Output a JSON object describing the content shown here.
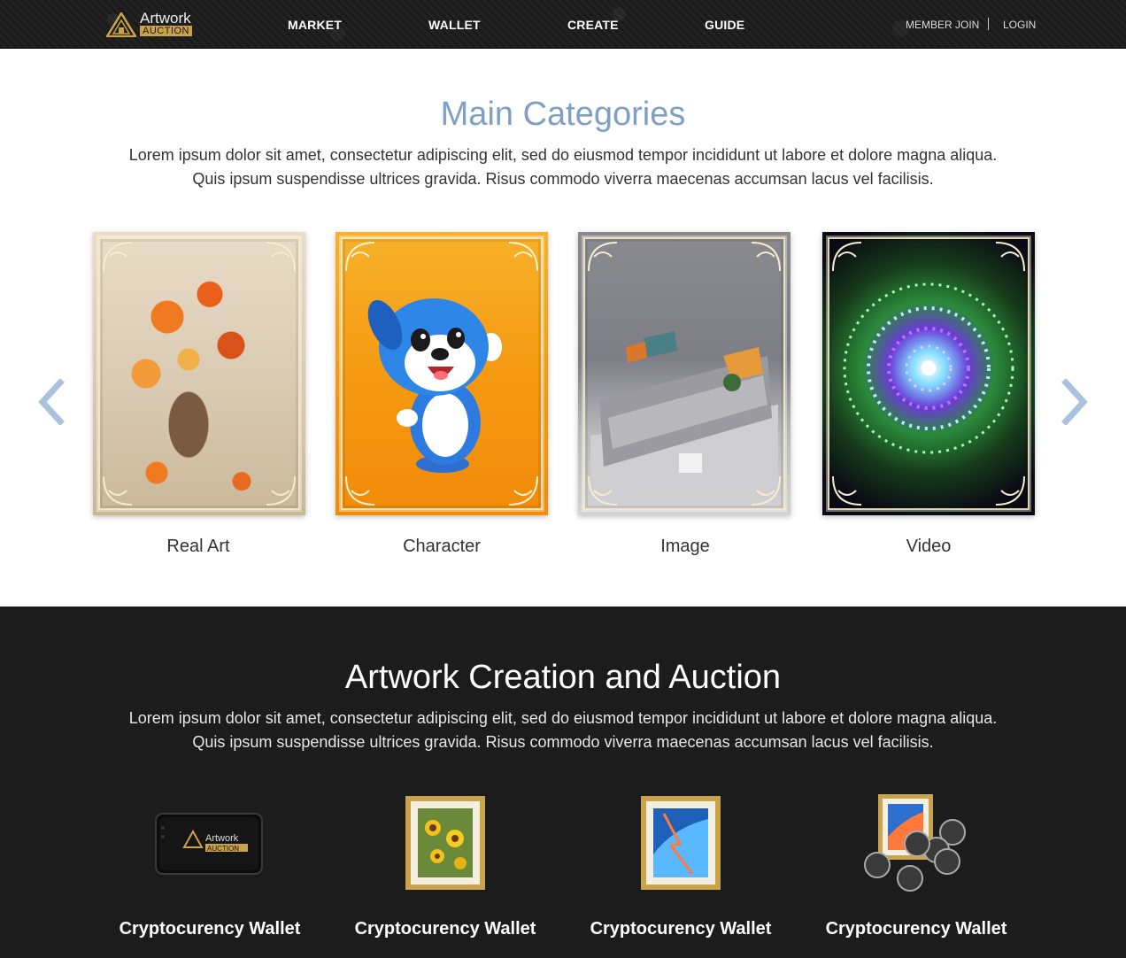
{
  "header": {
    "logo": {
      "line1": "Artwork",
      "line2": "AUCTION"
    },
    "nav": [
      "MARKET",
      "WALLET",
      "CREATE",
      "GUIDE"
    ],
    "auth": {
      "join": "MEMBER JOIN",
      "login": "LOGIN"
    }
  },
  "categories": {
    "title": "Main Categories",
    "desc_line1": "Lorem ipsum dolor sit amet, consectetur adipiscing elit, sed do eiusmod tempor incididunt ut labore et dolore magna aliqua.",
    "desc_line2": "Quis ipsum suspendisse ultrices gravida. Risus commodo viverra maecenas accumsan lacus vel facilisis.",
    "items": [
      {
        "label": "Real Art"
      },
      {
        "label": "Character"
      },
      {
        "label": "Image"
      },
      {
        "label": "Video"
      }
    ]
  },
  "auction": {
    "title": "Artwork Creation and Auction",
    "desc_line1": "Lorem ipsum dolor sit amet, consectetur adipiscing elit, sed do eiusmod tempor incididunt ut labore et dolore magna aliqua.",
    "desc_line2": "Quis ipsum suspendisse ultrices gravida. Risus commodo viverra maecenas accumsan lacus vel facilisis.",
    "features": [
      {
        "label": "Cryptocurency Wallet",
        "icon": "wallet-icon"
      },
      {
        "label": "Cryptocurency Wallet",
        "icon": "sunflower-frame-icon"
      },
      {
        "label": "Cryptocurency Wallet",
        "icon": "blue-art-frame-icon"
      },
      {
        "label": "Cryptocurency Wallet",
        "icon": "frame-coins-icon"
      }
    ]
  },
  "colors": {
    "accent_title": "#7f9fc6",
    "gold": "#c9a24a",
    "dark_bg": "#1c1c1c",
    "arrow": "#a9c2de"
  }
}
